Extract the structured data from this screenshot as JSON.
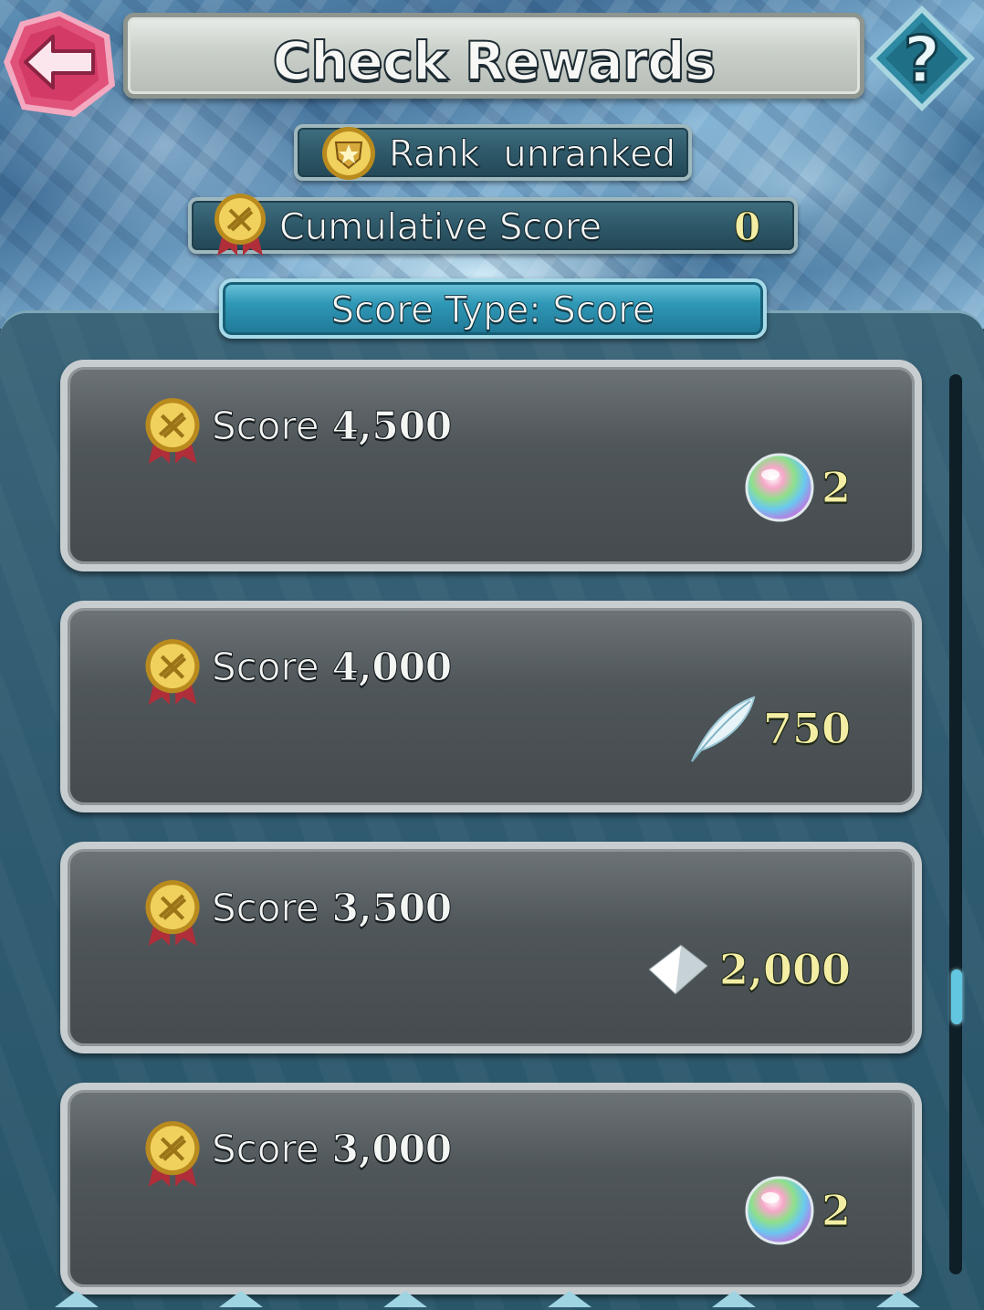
{
  "header": {
    "title": "Check Rewards",
    "back_icon": "back-arrow-icon",
    "help_icon": "help-question-icon",
    "back_color": "#e0527a",
    "help_color": "#2e8aa3"
  },
  "rank": {
    "label": "Rank",
    "value": "unranked",
    "icon": "rank-shield-icon"
  },
  "cumulative": {
    "label": "Cumulative Score",
    "value": "0",
    "icon": "score-medal-icon"
  },
  "score_type": {
    "label": "Score Type: Score"
  },
  "rewards": [
    {
      "label": "Score",
      "value": "4,500",
      "reward_icon": "orb-icon",
      "quantity": "2"
    },
    {
      "label": "Score",
      "value": "4,000",
      "reward_icon": "feather-icon",
      "quantity": "750"
    },
    {
      "label": "Score",
      "value": "3,500",
      "reward_icon": "crystal-icon",
      "quantity": "2,000"
    },
    {
      "label": "Score",
      "value": "3,000",
      "reward_icon": "orb-icon",
      "quantity": "2"
    }
  ],
  "colors": {
    "accent_gold_text": "#f4eea5",
    "type_button": "#2f98b6",
    "scroll_thumb": "#62c6e0"
  }
}
